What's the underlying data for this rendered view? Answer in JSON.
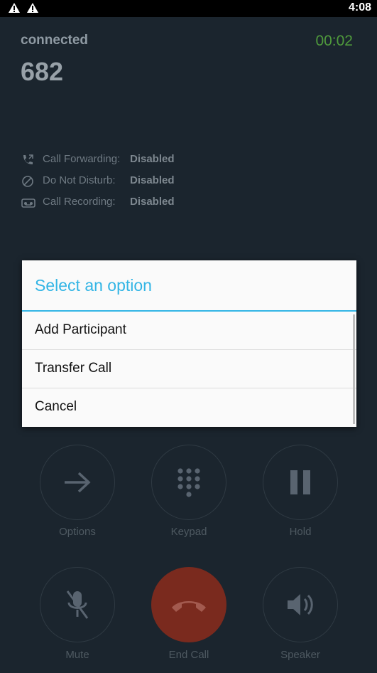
{
  "status_bar": {
    "time": "4:08",
    "icons": [
      "warning-icon",
      "warning-icon"
    ]
  },
  "call": {
    "state": "connected",
    "timer": "00:02",
    "number": "682",
    "features": [
      {
        "icon": "call-forward-icon",
        "label": "Call Forwarding:",
        "value": "Disabled"
      },
      {
        "icon": "do-not-disturb-icon",
        "label": "Do Not Disturb:",
        "value": "Disabled"
      },
      {
        "icon": "recording-icon",
        "label": "Call Recording:",
        "value": "Disabled"
      }
    ]
  },
  "controls": [
    {
      "icon": "arrow-right-icon",
      "label": "Options"
    },
    {
      "icon": "keypad-icon",
      "label": "Keypad"
    },
    {
      "icon": "pause-icon",
      "label": "Hold"
    },
    {
      "icon": "mic-off-icon",
      "label": "Mute"
    },
    {
      "icon": "phone-hangup-icon",
      "label": "End Call"
    },
    {
      "icon": "speaker-icon",
      "label": "Speaker"
    }
  ],
  "colors": {
    "accent": "#33b5e5",
    "timer": "#4f9a3c",
    "end_call": "#7a2a1e"
  },
  "dialog": {
    "title": "Select an option",
    "options": [
      "Add Participant",
      "Transfer Call",
      "Cancel"
    ]
  }
}
